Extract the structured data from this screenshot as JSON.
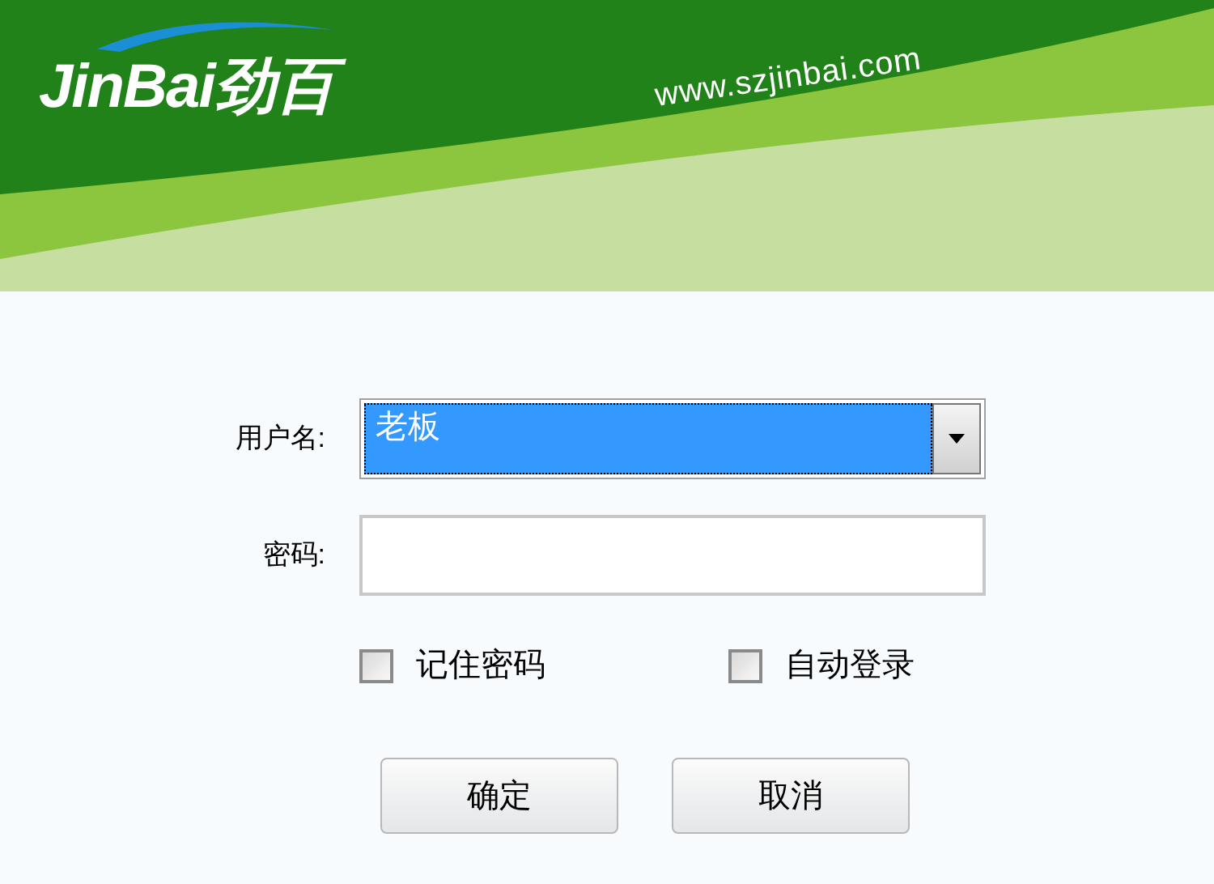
{
  "header": {
    "logo": "JinBai劲百",
    "website": "www.szjinbai.com"
  },
  "username": {
    "label": "用户名:",
    "value": "老板",
    "highlighted": true
  },
  "password": {
    "label": "密码:"
  },
  "options": [
    {
      "label": "记住密码",
      "checked": false
    },
    {
      "label": "自动登录",
      "checked": false
    }
  ],
  "buttons": [
    "确定",
    "取消"
  ]
}
